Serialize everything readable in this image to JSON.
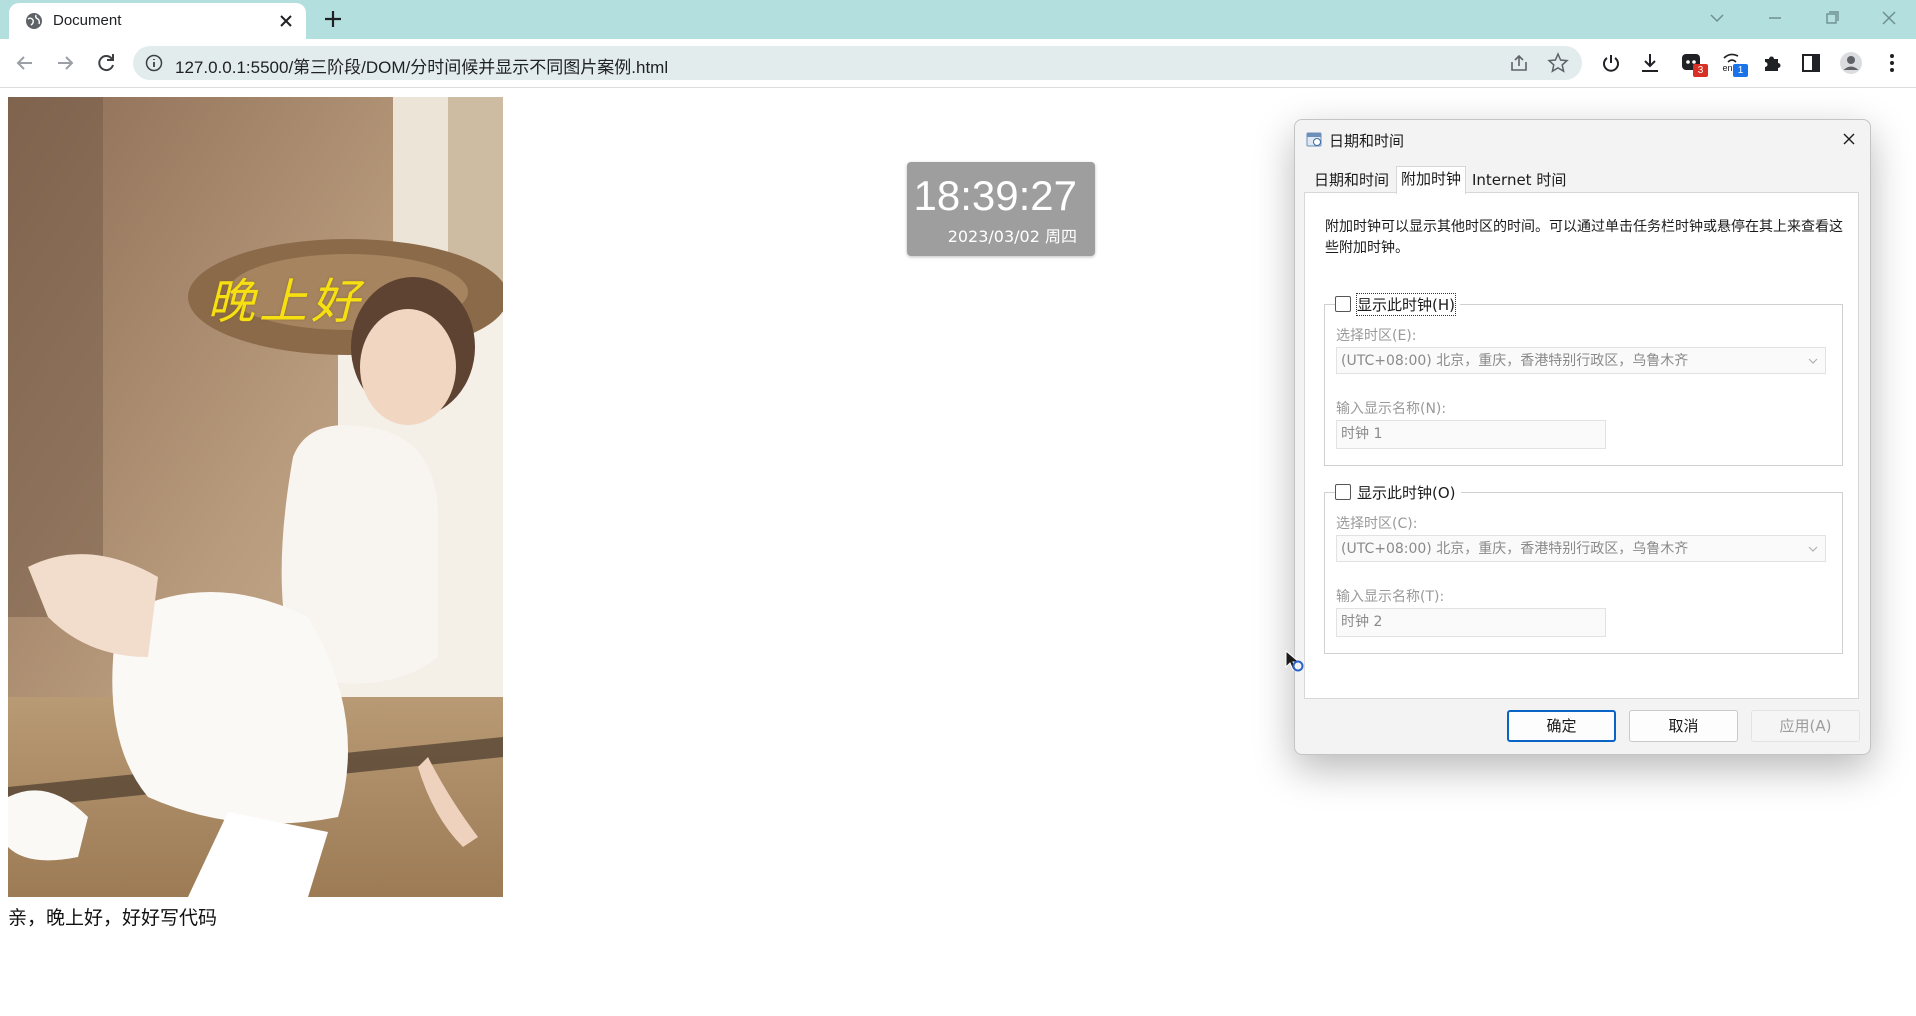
{
  "browser": {
    "tab_title": "Document",
    "url": "127.0.0.1:5500/第三阶段/DOM/分时间候并显示不同图片案例.html",
    "ext_badge_1": "3",
    "ext_badge_2": "1",
    "ext_lang": "en",
    "accent_color": "#b3dfdf"
  },
  "page": {
    "greeting": "晚上好",
    "caption": "亲，晚上好，好好写代码",
    "clock_time": "18:39:27",
    "clock_date": "2023/03/02 周四"
  },
  "dialog": {
    "title": "日期和时间",
    "tabs": [
      {
        "label": "日期和时间"
      },
      {
        "label": "附加时钟"
      },
      {
        "label": "Internet 时间"
      }
    ],
    "description": "附加时钟可以显示其他时区的时间。可以通过单击任务栏时钟或悬停在其上来查看这些附加时钟。",
    "clock1": {
      "checkbox_label": "显示此时钟(H)",
      "timezone_label": "选择时区(E):",
      "timezone_value": "(UTC+08:00) 北京，重庆，香港特别行政区，乌鲁木齐",
      "name_label": "输入显示名称(N):",
      "name_value": "时钟 1"
    },
    "clock2": {
      "checkbox_label": "显示此时钟(O)",
      "timezone_label": "选择时区(C):",
      "timezone_value": "(UTC+08:00) 北京，重庆，香港特别行政区，乌鲁木齐",
      "name_label": "输入显示名称(T):",
      "name_value": "时钟 2"
    },
    "buttons": {
      "ok": "确定",
      "cancel": "取消",
      "apply": "应用(A)"
    }
  }
}
